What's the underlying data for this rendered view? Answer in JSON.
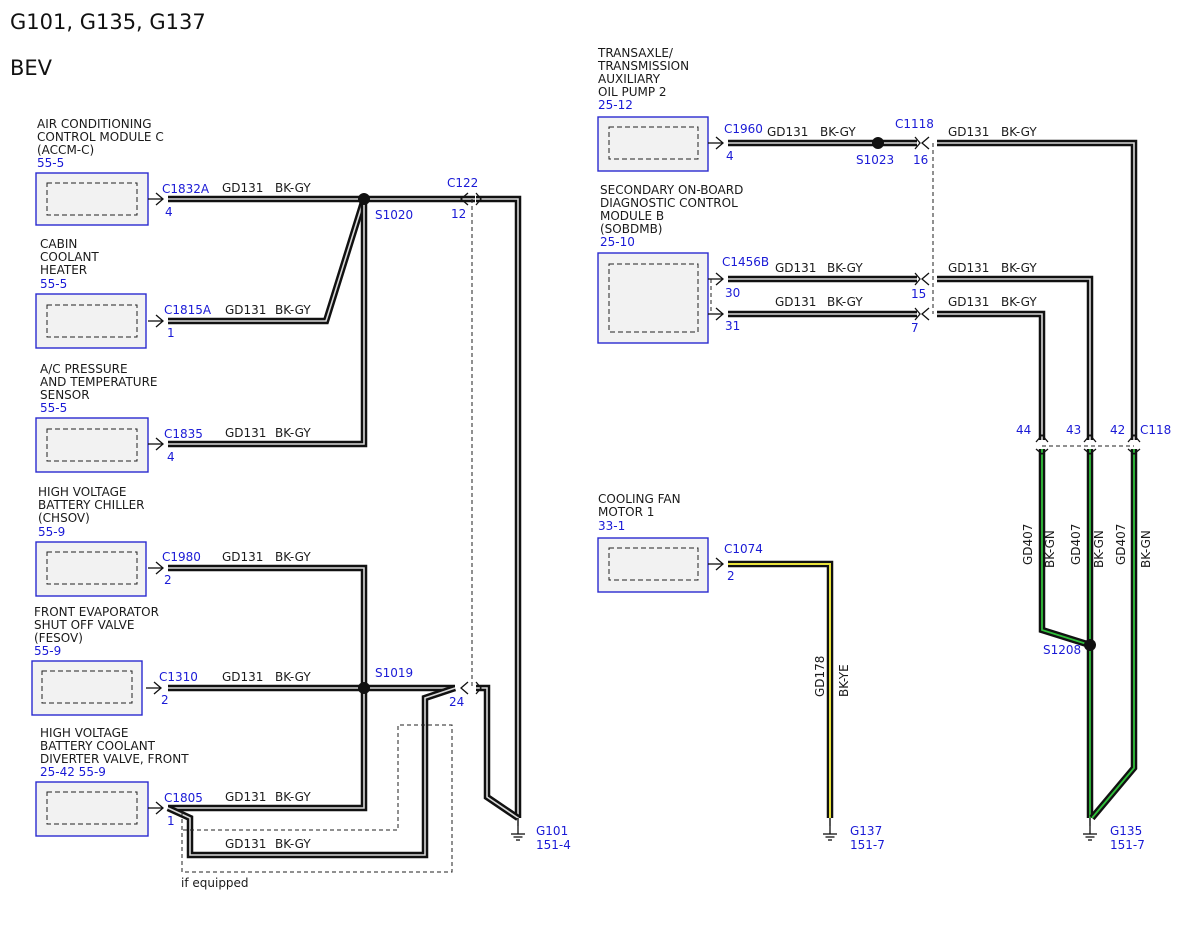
{
  "header": {
    "title": "G101, G135, G137",
    "subtitle": "BEV"
  },
  "components": [
    {
      "name": [
        "AIR CONDITIONING",
        "CONTROL MODULE C",
        "(ACCM-C)"
      ],
      "ref": "55-5",
      "connector": "C1832A",
      "pin": "4",
      "circuit": "GD131",
      "color": "BK-GY"
    },
    {
      "name": [
        "CABIN",
        "COOLANT",
        "HEATER"
      ],
      "ref": "55-5",
      "connector": "C1815A",
      "pin": "1",
      "circuit": "GD131",
      "color": "BK-GY"
    },
    {
      "name": [
        "A/C PRESSURE",
        "AND TEMPERATURE",
        "SENSOR"
      ],
      "ref": "55-5",
      "connector": "C1835",
      "pin": "4",
      "circuit": "GD131",
      "color": "BK-GY"
    },
    {
      "name": [
        "HIGH VOLTAGE",
        "BATTERY CHILLER",
        "(CHSOV)"
      ],
      "ref": "55-9",
      "connector": "C1980",
      "pin": "2",
      "circuit": "GD131",
      "color": "BK-GY"
    },
    {
      "name": [
        "FRONT EVAPORATOR",
        "SHUT OFF VALVE",
        "(FESOV)"
      ],
      "ref": "55-9",
      "connector": "C1310",
      "pin": "2",
      "circuit": "GD131",
      "color": "BK-GY"
    },
    {
      "name": [
        "HIGH VOLTAGE",
        "BATTERY COOLANT",
        "DIVERTER VALVE, FRONT"
      ],
      "ref": "25-42 55-9",
      "connector": "C1805",
      "pin": "1",
      "circuit": "GD131",
      "color": "BK-GY"
    },
    {
      "name": [
        "TRANSAXLE/",
        "TRANSMISSION",
        "AUXILIARY",
        "OIL PUMP 2"
      ],
      "ref": "25-12",
      "connector": "C1960",
      "pin": "4",
      "circuit": "GD131",
      "color": "BK-GY"
    },
    {
      "name": [
        "SECONDARY ON-BOARD",
        "DIAGNOSTIC CONTROL",
        "MODULE B",
        "(SOBDMB)"
      ],
      "ref": "25-10",
      "connector": "C1456B",
      "pins": [
        "30",
        "31"
      ],
      "circuit": "GD131",
      "color": "BK-GY"
    },
    {
      "name": [
        "COOLING FAN",
        "MOTOR 1"
      ],
      "ref": "33-1",
      "connector": "C1074",
      "pin": "2",
      "circuit": "GD178",
      "color": "BK-YE"
    }
  ],
  "wire": {
    "circuit": "GD131",
    "color": "BK-GY"
  },
  "wire_g135": {
    "circuit": "GD407",
    "color": "BK-GN"
  },
  "splices": [
    "S1020",
    "S1019",
    "S1023",
    "S1208"
  ],
  "inline": {
    "c122": {
      "name": "C122",
      "pins": [
        "12",
        "24"
      ]
    },
    "c1118": {
      "name": "C1118",
      "pins": [
        "16",
        "15",
        "7"
      ]
    },
    "c118": {
      "name": "C118",
      "pins": [
        "44",
        "43",
        "42"
      ]
    }
  },
  "grounds": [
    {
      "name": "G101",
      "ref": "151-4"
    },
    {
      "name": "G137",
      "ref": "151-7"
    },
    {
      "name": "G135",
      "ref": "151-7"
    }
  ],
  "note": "if equipped",
  "colors": {
    "label_blue": "#1a1ad6",
    "box_border": "#2a2ad0",
    "wire_gn": "#2fbf3a",
    "wire_ye": "#e8e23a"
  }
}
